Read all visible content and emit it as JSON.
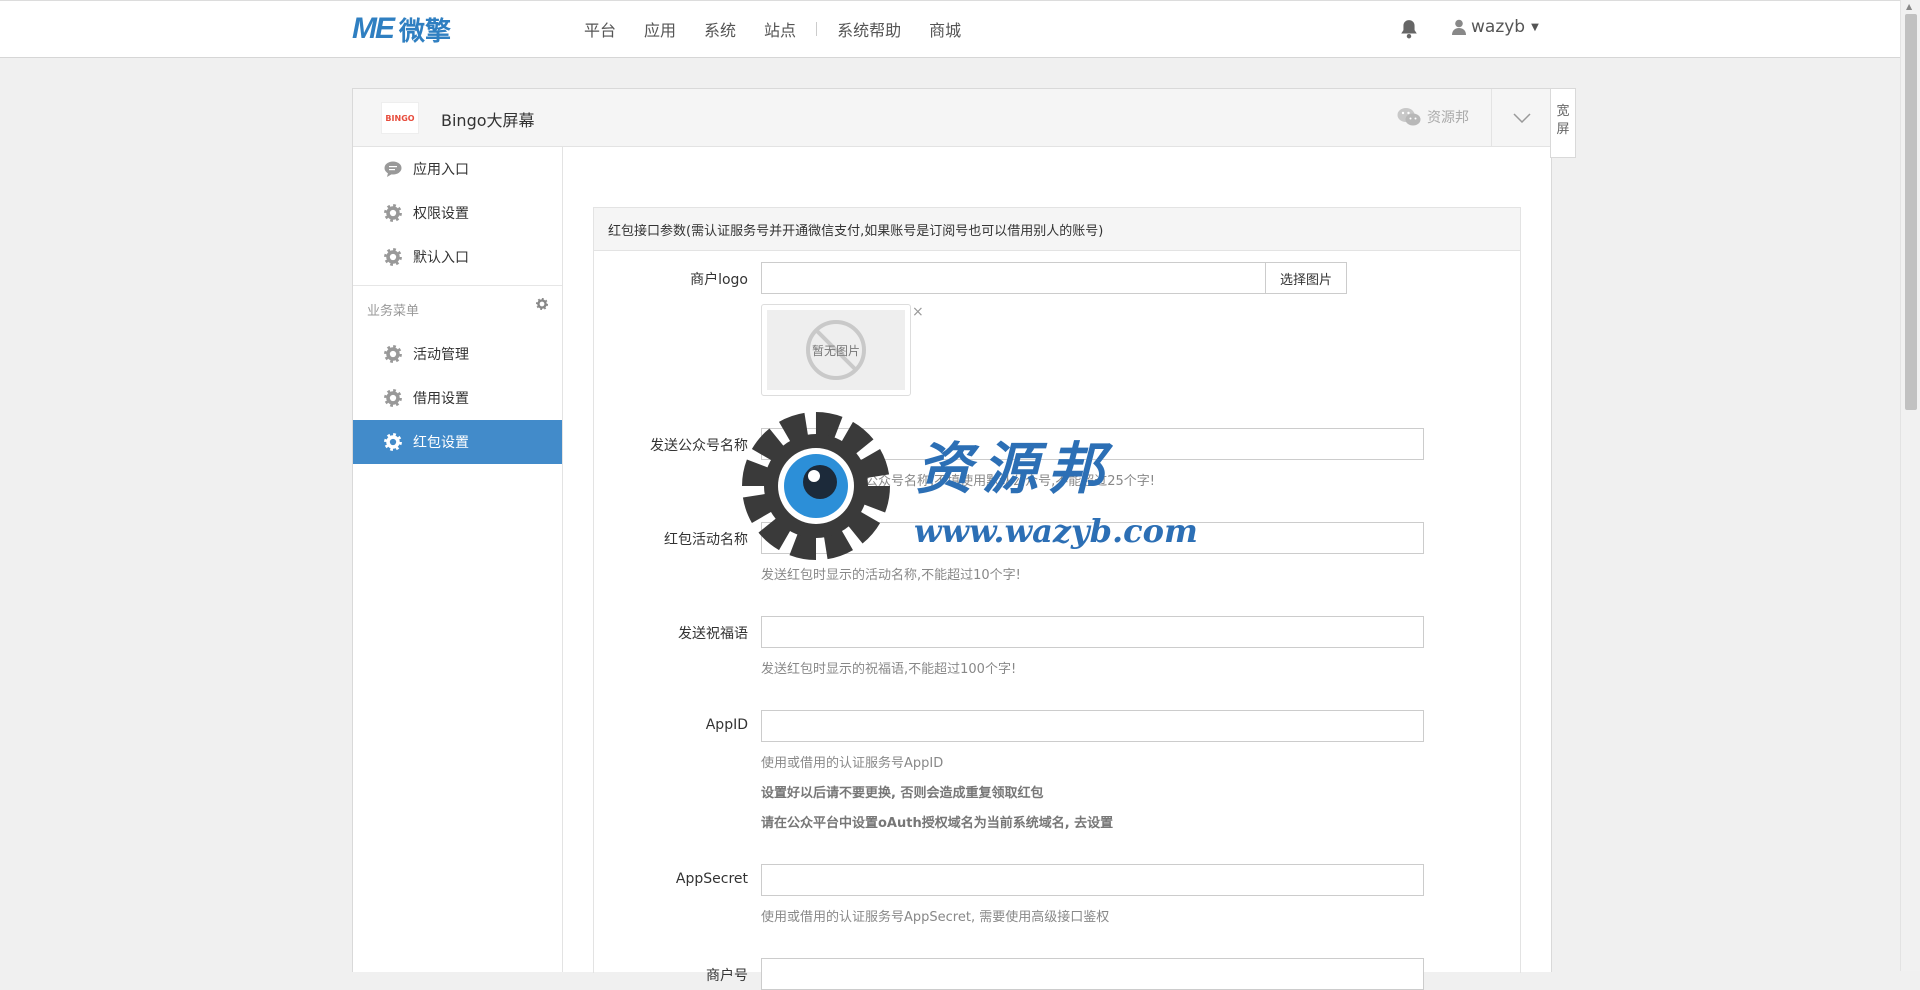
{
  "topbar": {
    "logo_mark": "ME",
    "logo_text": "微擎",
    "nav": [
      "平台",
      "应用",
      "系统",
      "站点",
      "系统帮助",
      "商城"
    ],
    "username": "wazyb"
  },
  "panel": {
    "app_icon_text": "BINGO",
    "app_title": "Bingo大屏幕",
    "account_name": "资源邦",
    "wide_button": "宽屏"
  },
  "sidebar": {
    "top_items": [
      {
        "label": "应用入口",
        "icon": "chat-icon"
      },
      {
        "label": "权限设置",
        "icon": "gear-icon"
      },
      {
        "label": "默认入口",
        "icon": "gear-icon"
      }
    ],
    "group_title": "业务菜单",
    "group_items": [
      {
        "label": "活动管理",
        "icon": "gear-icon"
      },
      {
        "label": "借用设置",
        "icon": "gear-icon"
      },
      {
        "label": "红包设置",
        "icon": "gear-icon",
        "active": true
      }
    ]
  },
  "form": {
    "card_title": "红包接口参数(需认证服务号并开通微信支付,如果账号是订阅号也可以借用别人的账号)",
    "fields": {
      "logo": {
        "label": "商户logo",
        "value": "",
        "button": "选择图片",
        "no_image": "暂无图片"
      },
      "sender": {
        "label": "发送公众号名称",
        "value": "",
        "help": "发送红包时显示的公众号名称,不填使用默认公众号,不能超过25个字!"
      },
      "activity": {
        "label": "红包活动名称",
        "value": "",
        "help": "发送红包时显示的活动名称,不能超过10个字!"
      },
      "wishing": {
        "label": "发送祝福语",
        "value": "",
        "help": "发送红包时显示的祝福语,不能超过100个字!"
      },
      "appid": {
        "label": "AppID",
        "value": "",
        "help": "使用或借用的认证服务号AppID",
        "help2": "设置好以后请不要更换, 否则会造成重复领取红包",
        "help3": "请在公众平台中设置oAuth授权域名为当前系统域名, 去设置"
      },
      "appsecret": {
        "label": "AppSecret",
        "value": "",
        "help": "使用或借用的认证服务号AppSecret, 需要使用高级接口鉴权"
      },
      "mchid": {
        "label": "商户号",
        "value": ""
      }
    }
  },
  "watermark": {
    "line1": "资源邦",
    "line2": "www.wazyb.com"
  },
  "colors": {
    "primary": "#428bca",
    "brand": "#2f7fc1",
    "watermark": "#2c6fb5"
  }
}
